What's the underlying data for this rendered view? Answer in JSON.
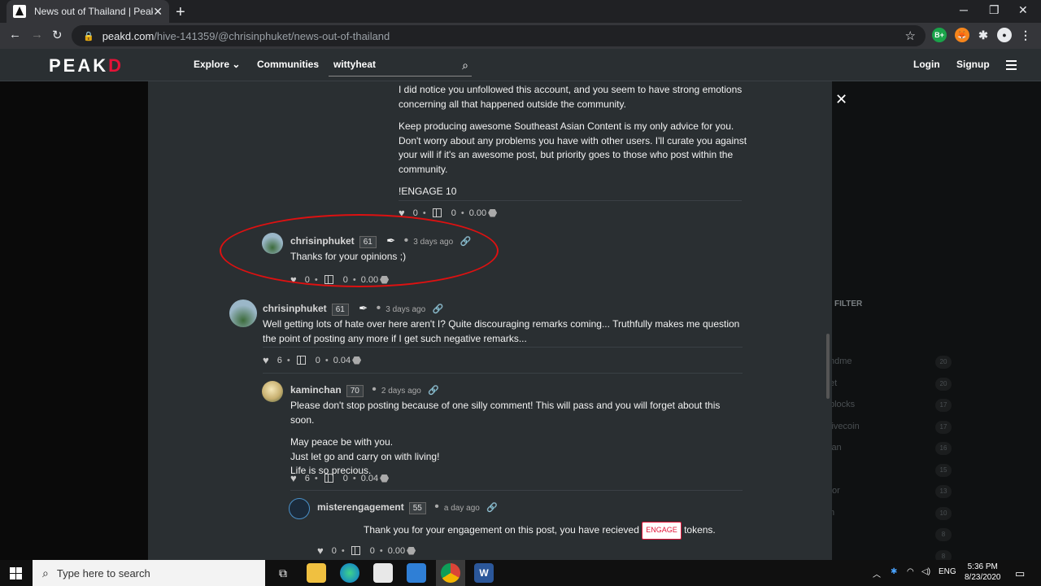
{
  "browser": {
    "tab_title": "News out of Thailand | PeakD",
    "url_host": "peakd.com",
    "url_path": "/hive-141359/@chrisinphuket/news-out-of-thailand"
  },
  "site": {
    "logo_main": "PEAK",
    "logo_accent": "D",
    "nav": {
      "explore": "Explore",
      "communities": "Communities"
    },
    "search_value": "wittyheat",
    "login": "Login",
    "signup": "Signup"
  },
  "background": {
    "filter_label": "FILTER",
    "rows": [
      {
        "label": "ndme",
        "count": "20"
      },
      {
        "label": "et",
        "count": "20"
      },
      {
        "label": "blocks",
        "count": "17"
      },
      {
        "label": "livecoin",
        "count": "17"
      },
      {
        "label": "ian",
        "count": "16"
      },
      {
        "label": "",
        "count": "15"
      },
      {
        "label": "tor",
        "count": "13"
      },
      {
        "label": "n",
        "count": "10"
      },
      {
        "label": "",
        "count": "8"
      },
      {
        "label": "",
        "count": "8"
      }
    ]
  },
  "comments": {
    "top": {
      "paragraphs": [
        "I did notice you unfollowed this account, and you seem to have strong emotions concerning all that happened outside the community.",
        "Keep producing awesome Southeast Asian Content is my only advice for you. Don't worry about any problems you have with other users. I'll curate you against your will if it's an awesome post, but priority goes to those who post within the community.",
        "!ENGAGE 10"
      ],
      "likes": "0",
      "gifts": "0",
      "payout": "0.00"
    },
    "c1": {
      "author": "chrisinphuket",
      "rep": "61",
      "time": "3 days ago",
      "text": "Thanks for your opinions ;)",
      "likes": "0",
      "gifts": "0",
      "payout": "0.00"
    },
    "c2": {
      "author": "chrisinphuket",
      "rep": "61",
      "time": "3 days ago",
      "text": "Well getting lots of hate over here aren't I? Quite discouraging remarks coming... Truthfully makes me question the point of posting any more if I get such negative remarks...",
      "likes": "6",
      "gifts": "0",
      "payout": "0.04"
    },
    "c3": {
      "author": "kaminchan",
      "rep": "70",
      "time": "2 days ago",
      "p1": "Please don't stop posting because of one silly comment! This will pass and you will forget about this soon.",
      "p2_lines": [
        "May peace be with you.",
        "Just let go and carry on with living!",
        "Life is so precious."
      ],
      "likes": "6",
      "gifts": "0",
      "payout": "0.04"
    },
    "c4": {
      "author": "misterengagement",
      "rep": "55",
      "time": "a day ago",
      "text_before": "Thank you for your engagement on this post, you have recieved",
      "badge": "ENGAGE",
      "text_after": "tokens.",
      "likes": "0",
      "gifts": "0",
      "payout": "0.00"
    }
  },
  "taskbar": {
    "search_placeholder": "Type here to search",
    "lang": "ENG",
    "time": "5:36 PM",
    "date": "8/23/2020"
  }
}
